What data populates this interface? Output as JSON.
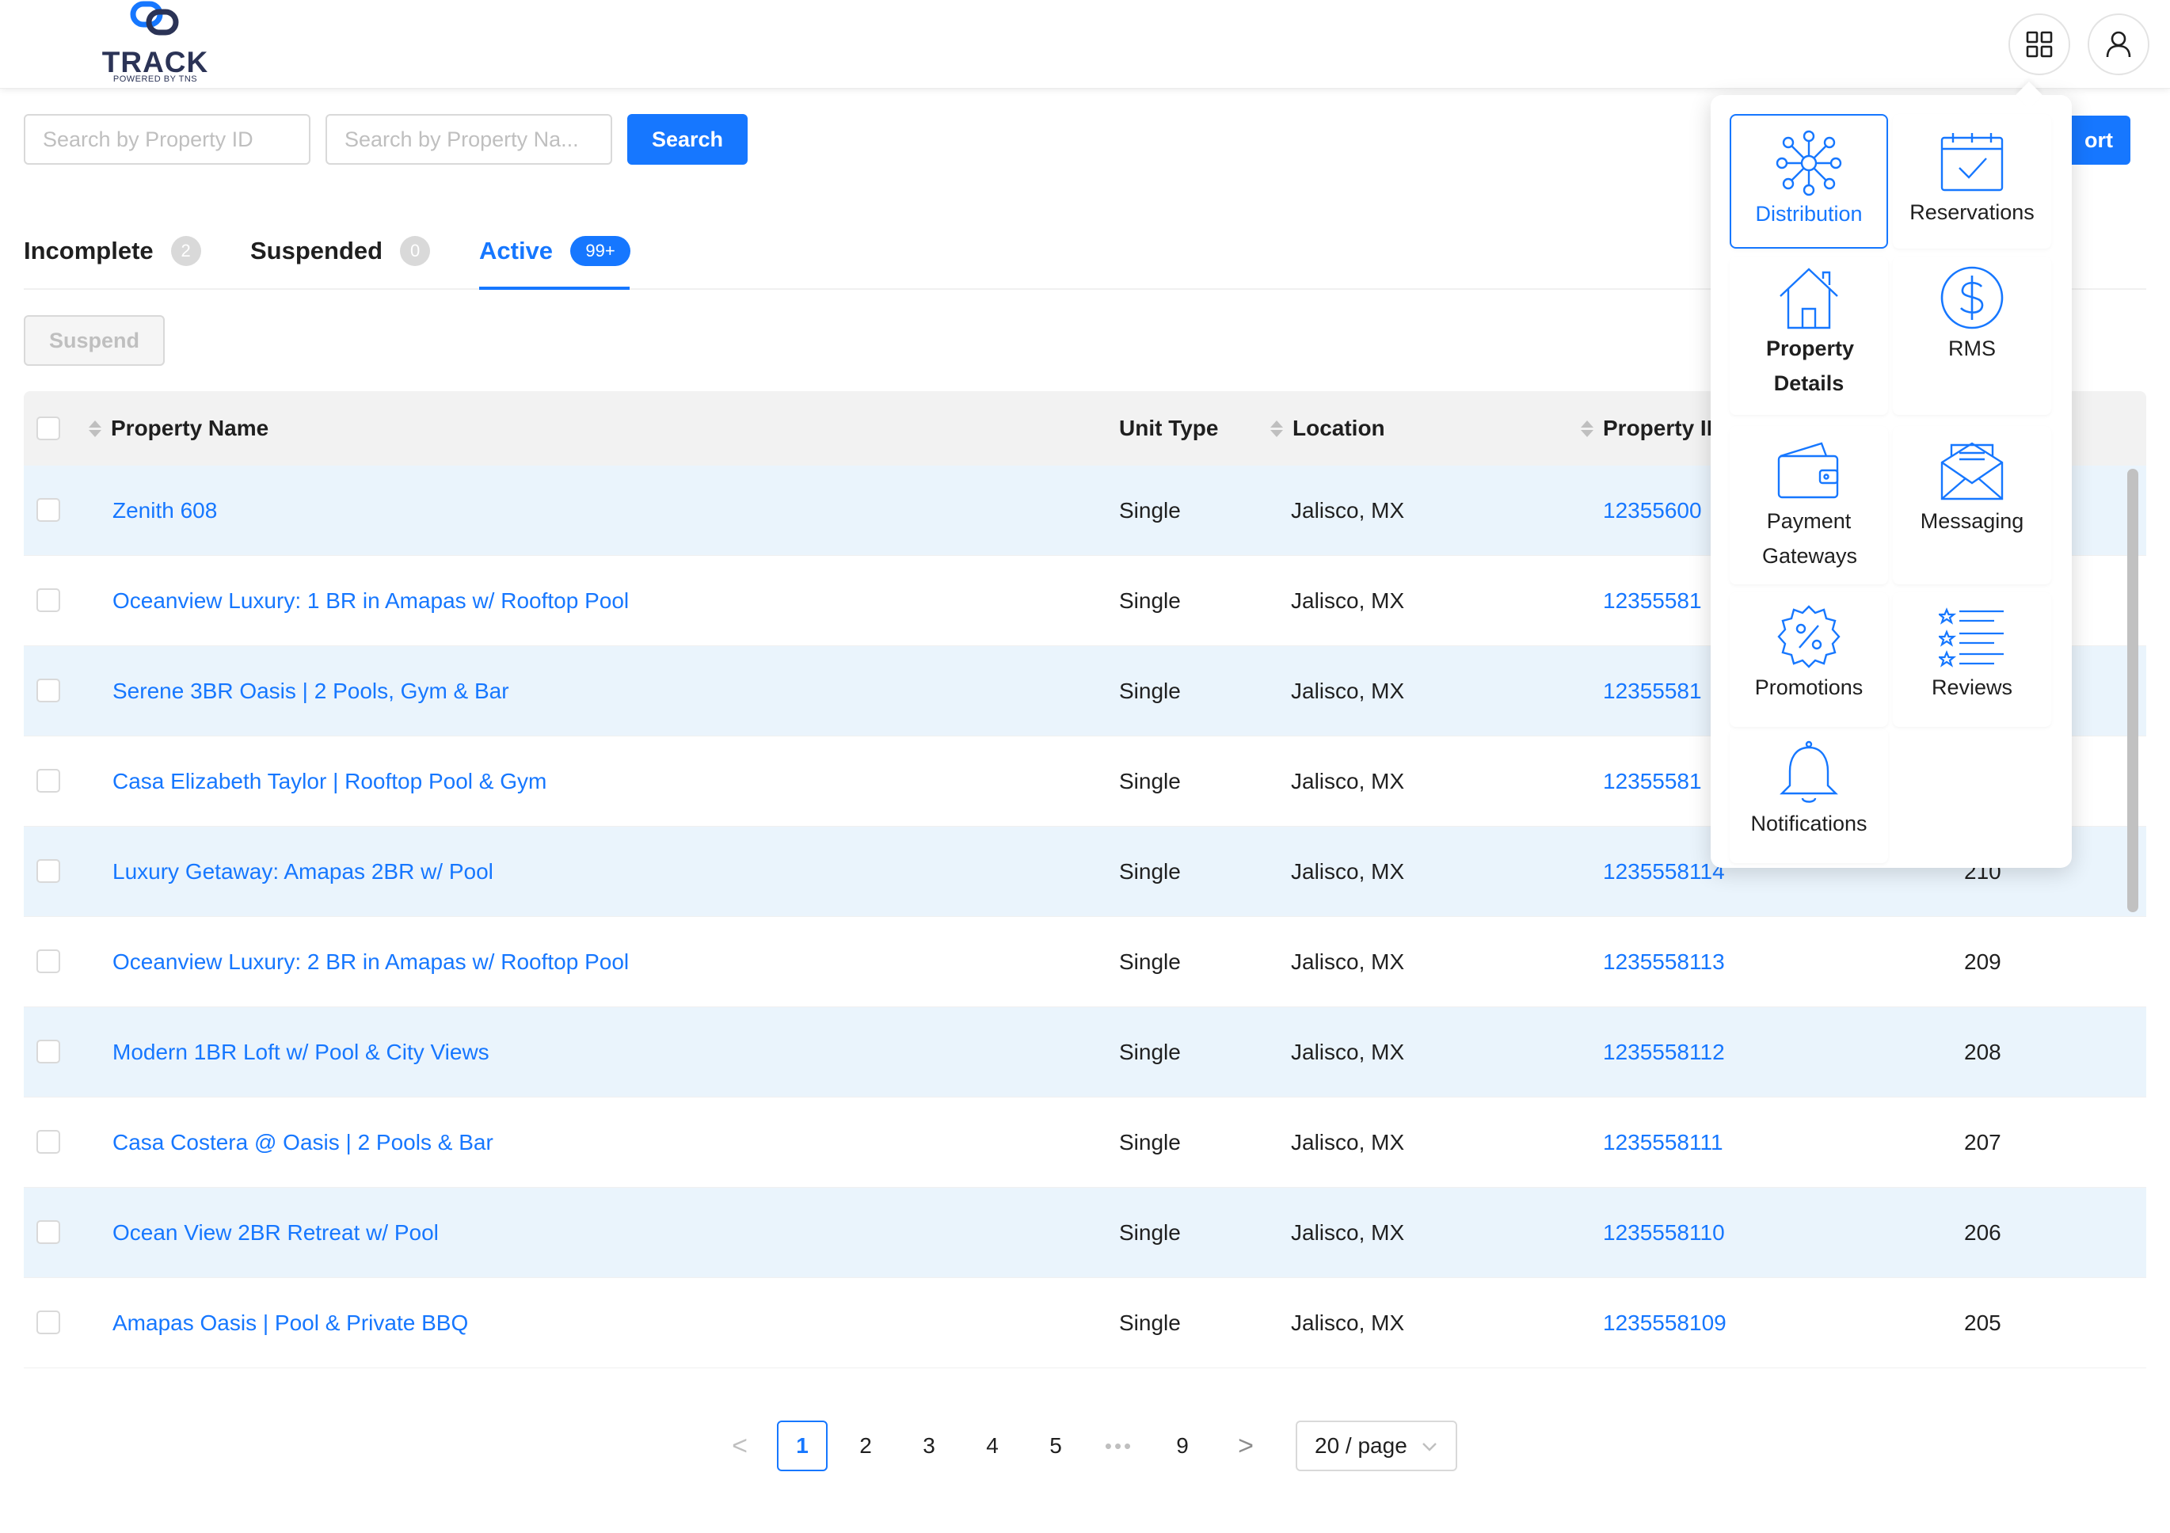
{
  "brand": {
    "name": "TRACK",
    "tagline": "POWERED BY TNS"
  },
  "header": {
    "apps_icon": "grid-icon",
    "user_icon": "user-icon"
  },
  "search": {
    "property_id_placeholder": "Search by Property ID",
    "property_name_placeholder": "Search by Property Na...",
    "search_label": "Search",
    "report_label": "ort"
  },
  "tabs": [
    {
      "label": "Incomplete",
      "count": "2",
      "active": false
    },
    {
      "label": "Suspended",
      "count": "0",
      "active": false
    },
    {
      "label": "Active",
      "count": "99+",
      "active": true
    }
  ],
  "actions": {
    "suspend_label": "Suspend"
  },
  "table": {
    "columns": [
      "Property Name",
      "Unit Type",
      "Location",
      "Property II"
    ],
    "rows": [
      {
        "name": "Zenith 608",
        "unit_type": "Single",
        "location": "Jalisco, MX",
        "property_id": "12355600",
        "extra": ""
      },
      {
        "name": "Oceanview Luxury: 1 BR in Amapas w/ Rooftop Pool",
        "unit_type": "Single",
        "location": "Jalisco, MX",
        "property_id": "12355581",
        "extra": ""
      },
      {
        "name": "Serene 3BR Oasis | 2 Pools, Gym & Bar",
        "unit_type": "Single",
        "location": "Jalisco, MX",
        "property_id": "12355581",
        "extra": ""
      },
      {
        "name": "Casa Elizabeth Taylor | Rooftop Pool & Gym",
        "unit_type": "Single",
        "location": "Jalisco, MX",
        "property_id": "12355581",
        "extra": ""
      },
      {
        "name": "Luxury Getaway: Amapas 2BR w/ Pool",
        "unit_type": "Single",
        "location": "Jalisco, MX",
        "property_id": "1235558114",
        "extra": "210"
      },
      {
        "name": "Oceanview Luxury: 2 BR in Amapas w/ Rooftop Pool",
        "unit_type": "Single",
        "location": "Jalisco, MX",
        "property_id": "1235558113",
        "extra": "209"
      },
      {
        "name": "Modern 1BR Loft w/ Pool & City Views",
        "unit_type": "Single",
        "location": "Jalisco, MX",
        "property_id": "1235558112",
        "extra": "208"
      },
      {
        "name": "Casa Costera @ Oasis | 2 Pools & Bar",
        "unit_type": "Single",
        "location": "Jalisco, MX",
        "property_id": "1235558111",
        "extra": "207"
      },
      {
        "name": "Ocean View 2BR Retreat w/ Pool",
        "unit_type": "Single",
        "location": "Jalisco, MX",
        "property_id": "1235558110",
        "extra": "206"
      },
      {
        "name": "Amapas Oasis | Pool & Private BBQ",
        "unit_type": "Single",
        "location": "Jalisco, MX",
        "property_id": "1235558109",
        "extra": "205"
      }
    ]
  },
  "pagination": {
    "prev": "<",
    "pages": [
      "1",
      "2",
      "3",
      "4",
      "5"
    ],
    "ellipsis": "•••",
    "last": "9",
    "next": ">",
    "current": "1",
    "page_size": "20 / page"
  },
  "app_menu": [
    {
      "label": "Distribution",
      "icon": "distribution-network-icon",
      "selected": true
    },
    {
      "label": "Reservations",
      "icon": "calendar-check-icon",
      "selected": false
    },
    {
      "label": "Property Details",
      "icon": "house-icon",
      "selected": false
    },
    {
      "label": "RMS",
      "icon": "dollar-circle-icon",
      "selected": false
    },
    {
      "label": "Payment Gateways",
      "icon": "wallet-icon",
      "selected": false
    },
    {
      "label": "Messaging",
      "icon": "envelope-icon",
      "selected": false
    },
    {
      "label": "Promotions",
      "icon": "percent-badge-icon",
      "selected": false
    },
    {
      "label": "Reviews",
      "icon": "star-list-icon",
      "selected": false
    },
    {
      "label": "Notifications",
      "icon": "bell-icon",
      "selected": false
    }
  ],
  "colors": {
    "accent": "#1677ff",
    "row_alt": "#eaf4fc",
    "brand_navy": "#2b3356"
  }
}
